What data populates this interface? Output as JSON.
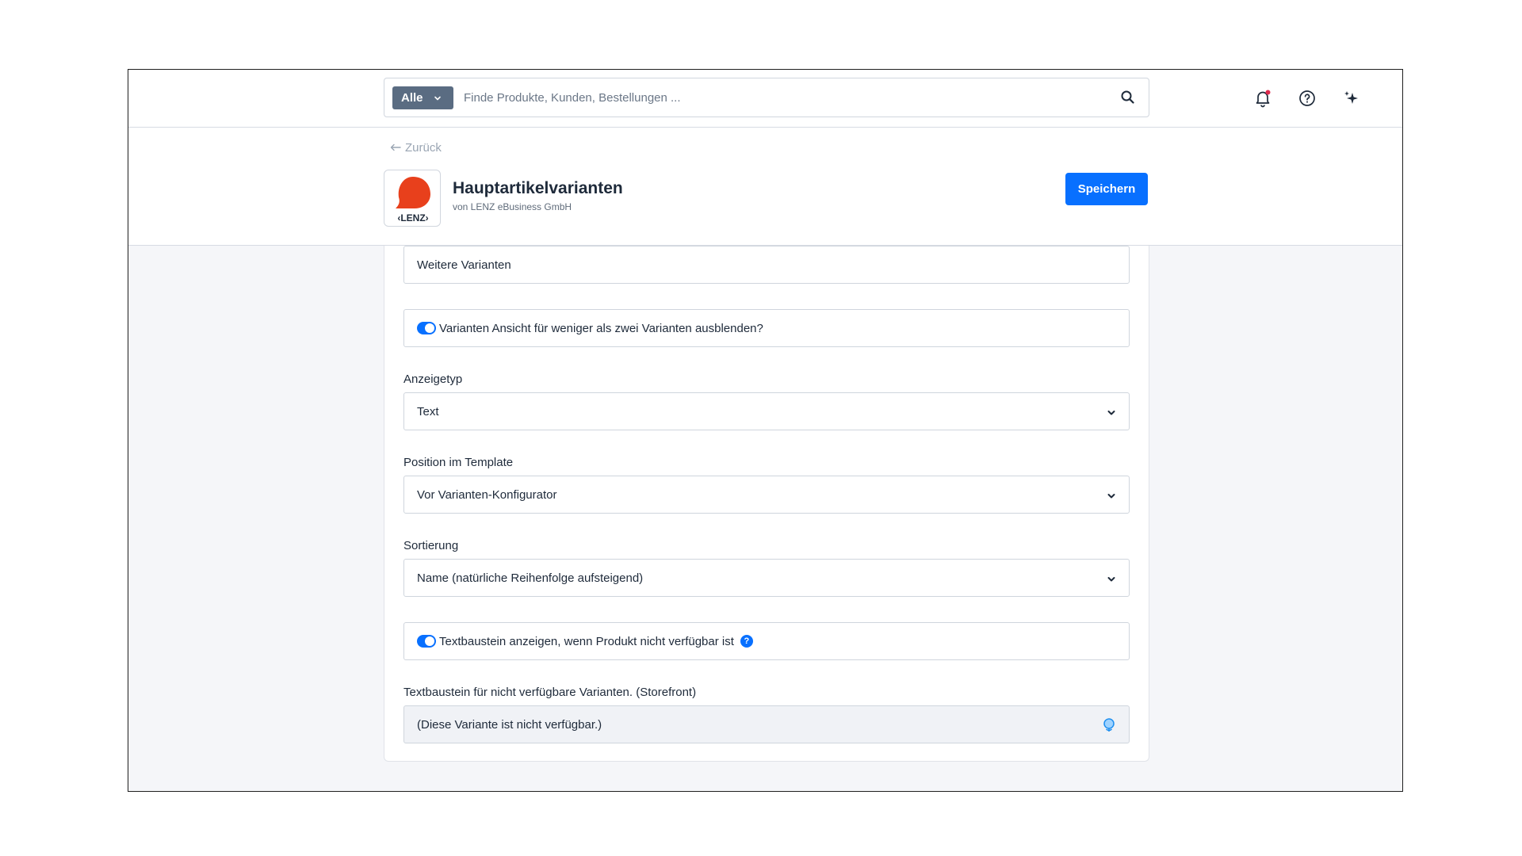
{
  "search": {
    "filter_label": "Alle",
    "placeholder": "Finde Produkte, Kunden, Bestellungen ..."
  },
  "header": {
    "back_label": "Zurück",
    "app_title": "Hauptartikelvarianten",
    "app_vendor": "von LENZ eBusiness GmbH",
    "logo_text": "‹LENZ›",
    "save_label": "Speichern"
  },
  "form": {
    "more_variants_value": "Weitere Varianten",
    "hide_toggle_label": "Varianten Ansicht für weniger als zwei Varianten ausblenden?",
    "hide_toggle_on": true,
    "display_type_label": "Anzeigetyp",
    "display_type_value": "Text",
    "position_label": "Position im Template",
    "position_value": "Vor Varianten-Konfigurator",
    "sort_label": "Sortierung",
    "sort_value": "Name (natürliche Reihenfolge aufsteigend)",
    "textblock_toggle_label": "Textbaustein anzeigen, wenn Produkt nicht verfügbar ist",
    "textblock_toggle_on": true,
    "textblock_help": "?",
    "textblock_field_label": "Textbaustein für nicht verfügbare Varianten. (Storefront)",
    "textblock_field_value": "(Diese Variante ist nicht verfügbar.)"
  },
  "colors": {
    "primary": "#0870ff",
    "filter_button": "#5a6c82",
    "logo_red": "#e8401c",
    "notification_dot": "#de294c"
  }
}
